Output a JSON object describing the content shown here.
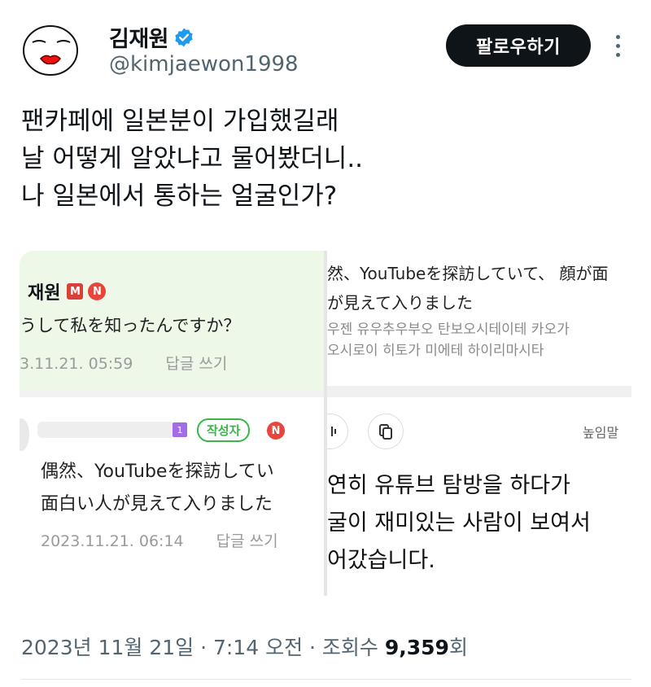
{
  "user": {
    "display_name": "김재원",
    "handle": "@kimjaewon1998",
    "verified": true,
    "avatar_icon": "drawn-face-avatar-icon"
  },
  "actions": {
    "follow_label": "팔로우하기",
    "more_icon": "more-vertical-icon"
  },
  "tweet": {
    "lines": [
      "팬카페에 일본분이 가입했길래",
      "날 어떻게 알았냐고 물어봤더니..",
      "나 일본에서 통하는 얼굴인가?"
    ]
  },
  "media": {
    "left_panel": {
      "author": "재원",
      "badge_m": "M",
      "badge_n": "N",
      "question": "うして私を知ったんですか？",
      "question_time": "3.11.21. 05:59",
      "reply_label": "답글 쓰기",
      "level_badge": "1",
      "author_tag": "작성자",
      "answer_line1": "偶然、YouTubeを探訪してい",
      "answer_line2": "面白い人が見えて入りました",
      "answer_time": "2023.11.21. 06:14"
    },
    "right_panel": {
      "source_line1": "然、YouTubeを探訪していて、 顔が面",
      "source_line2": "が見えて入りました",
      "roman_line1": "우젠 유우추우부오 탄보오시테이테 카오가",
      "roman_line2": "오시로이 히토가 미에테 하이리마시타",
      "honorific_label": "높임말",
      "translation_line1": "연히 유튜브 탐방을 하다가",
      "translation_line2": "굴이 재미있는 사람이 보여서",
      "translation_line3": "어갔습니다."
    }
  },
  "meta": {
    "date_time": "2023년 11월 21일 · 7:14 오전 · 조회수 ",
    "views": "9,359",
    "views_suffix": "회"
  }
}
